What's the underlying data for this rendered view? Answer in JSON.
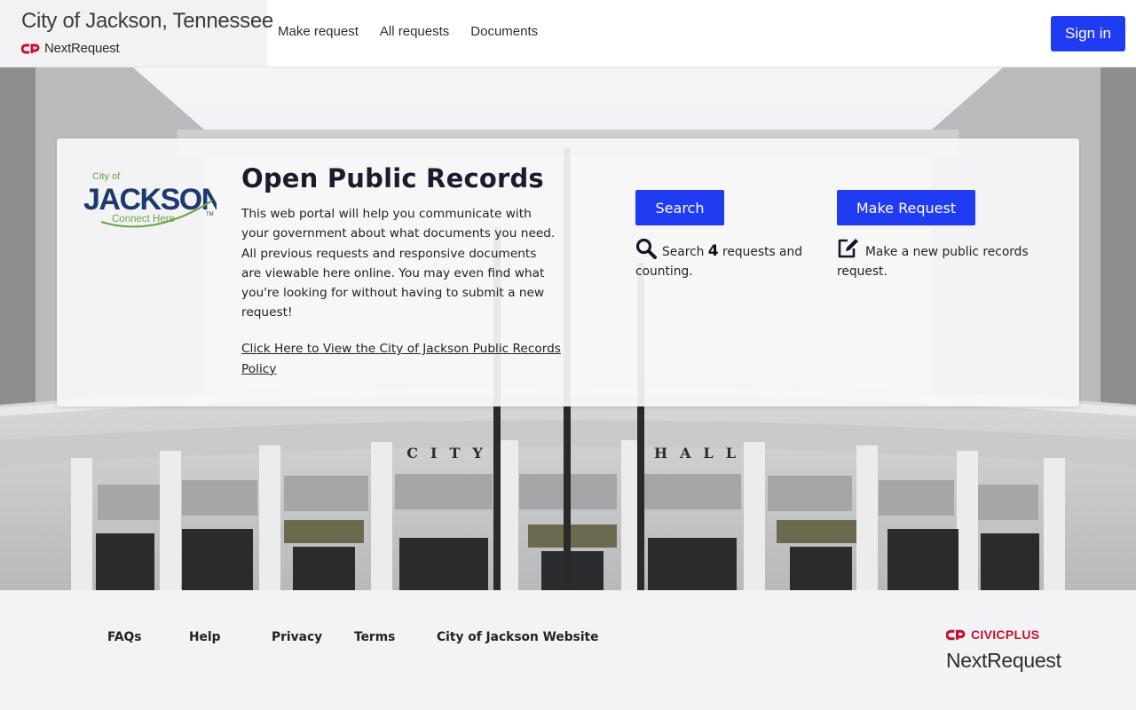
{
  "header": {
    "site_title": "City of Jackson, Tennessee",
    "brand_name": "NextRequest",
    "nav": [
      "Make request",
      "All requests",
      "Documents"
    ],
    "signin_label": "Sign in"
  },
  "card": {
    "logo": {
      "line1": "City of",
      "line2": "JACKSON",
      "line3": "Connect Here",
      "tm": "TM"
    },
    "title": "Open Public Records",
    "intro": "This web portal will help you communicate with your government about what documents you need. All previous requests and responsive documents are viewable here online. You may even find what you're looking for without having to submit a new request!",
    "policy_link": "Click Here to View the City of Jackson Public Records Policy",
    "search_button": "Search",
    "search_prefix": "Search",
    "search_count": "4",
    "search_suffix": "requests and counting.",
    "make_button": "Make Request",
    "make_text": "Make a new public records request."
  },
  "hero": {
    "building_left": "CITY",
    "building_right": "HALL"
  },
  "footer": {
    "links": [
      "FAQs",
      "Help",
      "Privacy",
      "Terms",
      "City of Jackson Website"
    ],
    "civic_brand": "CIVICPLUS",
    "product": "NextRequest"
  },
  "colors": {
    "primary": "#1f3cf2",
    "civicplus_red": "#c8102e",
    "logo_navy": "#1d3a6e",
    "logo_green": "#6aa543"
  }
}
